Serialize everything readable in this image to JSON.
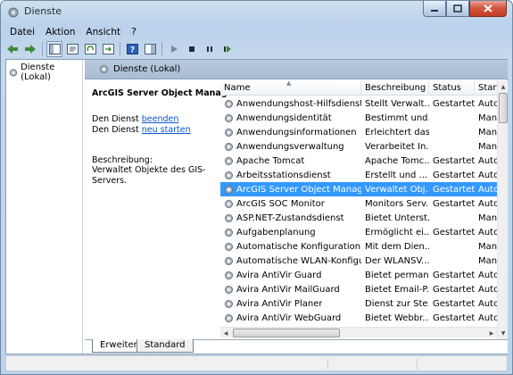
{
  "window": {
    "title": "Dienste"
  },
  "menu": [
    "Datei",
    "Aktion",
    "Ansicht",
    "?"
  ],
  "toolbar": {
    "buttons": [
      "back-icon",
      "forward-icon",
      "show-tree-icon",
      "properties-icon",
      "refresh-icon",
      "export-icon",
      "help-icon",
      "show-action-pane-icon",
      "start-icon",
      "stop-icon",
      "pause-icon",
      "restart-icon"
    ]
  },
  "tree": {
    "root_label": "Dienste (Lokal)"
  },
  "header": {
    "title": "Dienste (Lokal)"
  },
  "detail": {
    "service_name": "ArcGIS Server Object Manager",
    "stop_prefix": "Den Dienst",
    "stop_link": "beenden",
    "restart_prefix": "Den Dienst",
    "restart_link": "neu starten",
    "description_label": "Beschreibung:",
    "description": "Verwaltet Objekte des GIS-Servers."
  },
  "table": {
    "columns": [
      "Name",
      "Beschreibung",
      "Status",
      "Startt"
    ],
    "rows": [
      {
        "name": "Anwendungshost-Hilfsdienst",
        "desc": "Stellt Verwalt...",
        "status": "Gestartet",
        "start": "Autor"
      },
      {
        "name": "Anwendungsidentität",
        "desc": "Bestimmt und...",
        "status": "",
        "start": "Manu"
      },
      {
        "name": "Anwendungsinformationen",
        "desc": "Erleichtert das...",
        "status": "",
        "start": "Manu"
      },
      {
        "name": "Anwendungsverwaltung",
        "desc": "Verarbeitet In...",
        "status": "",
        "start": "Manu"
      },
      {
        "name": "Apache Tomcat",
        "desc": "Apache Tomc...",
        "status": "Gestartet",
        "start": "Autor"
      },
      {
        "name": "Arbeitsstationsdienst",
        "desc": "Erstellt und ...",
        "status": "Gestartet",
        "start": "Autor"
      },
      {
        "name": "ArcGIS Server Object Manager",
        "desc": "Verwaltet Obj...",
        "status": "Gestartet",
        "start": "Autor",
        "selected": true
      },
      {
        "name": "ArcGIS SOC Monitor",
        "desc": "Monitors Serv...",
        "status": "Gestartet",
        "start": "Autor"
      },
      {
        "name": "ASP.NET-Zustandsdienst",
        "desc": "Bietet Unterst...",
        "status": "",
        "start": "Manu"
      },
      {
        "name": "Aufgabenplanung",
        "desc": "Ermöglicht ei...",
        "status": "Gestartet",
        "start": "Autor"
      },
      {
        "name": "Automatische Konfiguration (v...",
        "desc": "Mit dem Dien...",
        "status": "",
        "start": "Manu"
      },
      {
        "name": "Automatische WLAN-Konfigura...",
        "desc": "Der WLANSV...",
        "status": "",
        "start": "Manu"
      },
      {
        "name": "Avira AntiVir Guard",
        "desc": "Bietet perman...",
        "status": "Gestartet",
        "start": "Autor"
      },
      {
        "name": "Avira AntiVir MailGuard",
        "desc": "Bietet Email-P...",
        "status": "Gestartet",
        "start": "Autor"
      },
      {
        "name": "Avira AntiVir Planer",
        "desc": "Dienst zur Ste...",
        "status": "Gestartet",
        "start": "Autor"
      },
      {
        "name": "Avira AntiVir WebGuard",
        "desc": "Bietet Webbr...",
        "status": "Gestartet",
        "start": "Autor"
      }
    ]
  },
  "tabs": {
    "extended": "Erweitert",
    "standard": "Standard"
  },
  "colors": {
    "selection": "#3399ff",
    "link": "#0a56c8",
    "header_band": "#b8c9dc"
  }
}
